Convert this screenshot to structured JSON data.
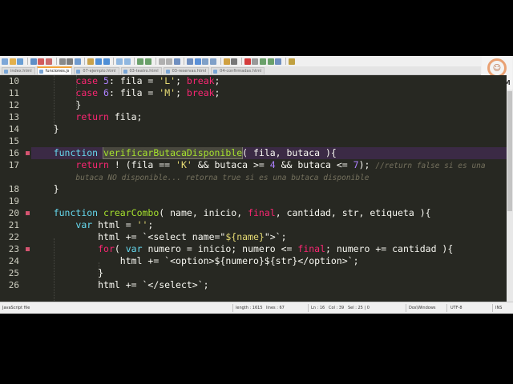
{
  "tabs": [
    {
      "label": "index.html",
      "active": false
    },
    {
      "label": "funciones.js",
      "active": true
    },
    {
      "label": "07-ejemplo.html",
      "active": false
    },
    {
      "label": "03-teatro.html",
      "active": false
    },
    {
      "label": "03-reservas.html",
      "active": false
    },
    {
      "label": "04-confirmadas.html",
      "active": false
    }
  ],
  "logo": {
    "text": "BLOOM",
    "mark": "☺"
  },
  "editor": {
    "lines": [
      {
        "num": "10",
        "fold": false
      },
      {
        "num": "11",
        "fold": false
      },
      {
        "num": "12",
        "fold": false
      },
      {
        "num": "13",
        "fold": false
      },
      {
        "num": "14",
        "fold": false
      },
      {
        "num": "15",
        "fold": false
      },
      {
        "num": "16",
        "fold": true
      },
      {
        "num": "17",
        "fold": false
      },
      {
        "num": "",
        "fold": false
      },
      {
        "num": "18",
        "fold": false
      },
      {
        "num": "19",
        "fold": false
      },
      {
        "num": "20",
        "fold": true
      },
      {
        "num": "21",
        "fold": false
      },
      {
        "num": "22",
        "fold": false
      },
      {
        "num": "23",
        "fold": true
      },
      {
        "num": "24",
        "fold": false
      },
      {
        "num": "25",
        "fold": false
      },
      {
        "num": "26",
        "fold": false
      }
    ],
    "code": {
      "l10": {
        "kw": "case",
        "num": "5",
        "mid": ": fila = ",
        "str": "'L'",
        "sep": "; ",
        "brk": "break",
        "end": ";"
      },
      "l11": {
        "kw": "case",
        "num": "6",
        "mid": ": fila = ",
        "str": "'M'",
        "sep": "; ",
        "brk": "break",
        "end": ";"
      },
      "l12": {
        "text": "}"
      },
      "l13": {
        "kw": "return",
        "rest": " fila;"
      },
      "l14": {
        "text": "}"
      },
      "l16": {
        "kw": "function",
        "name": "verificarButacaDisponible",
        "sig": "( fila, butaca ){"
      },
      "l17": {
        "kw": "return",
        "p1": " ! (fila == ",
        "s1": "'K'",
        "p2": " && butaca >= ",
        "n1": "4",
        "p3": " && butaca <= ",
        "n2": "7",
        "p4": "); ",
        "comment": "//return false si es una"
      },
      "l17b": {
        "comment": "butaca NO disponible... retorna true si es una butaca disponible"
      },
      "l18": {
        "text": "}"
      },
      "l20": {
        "kw": "function",
        "name": "crearCombo",
        "sig1": "( name, inicio, ",
        "finalkw": "final",
        "sig2": ", cantidad, str, etiqueta ){"
      },
      "l21": {
        "kw": "var",
        "mid": " html = ",
        "str": "''",
        "end": ";"
      },
      "l22": {
        "pre": "html += `<select name=\"",
        "tmpl": "${name}",
        "post": "\">`;"
      },
      "l23": {
        "kw": "for",
        "p1": "( ",
        "kw2": "var",
        "p2": " numero = inicio; numero <= ",
        "finalkw": "final",
        "p3": "; numero += cantidad ){"
      },
      "l24": {
        "pre": "html += `<option>",
        "t1": "${numero}",
        "t2": "${str}",
        "post": "</option>`;"
      },
      "l25": {
        "text": "}"
      },
      "l26": {
        "pre": "html += `</select>`;"
      }
    }
  },
  "statusbar": {
    "filetype": "JavaScript file",
    "length": "length : 1615",
    "lines": "lines : 67",
    "ln": "Ln : 16",
    "col": "Col : 39",
    "sel": "Sel : 25 | 0",
    "eol": "Dos\\Windows",
    "encoding": "UTF-8",
    "mode": "INS"
  },
  "colors": {
    "editor_bg": "#272822",
    "keyword": "#66d9ef",
    "control": "#f92672",
    "string": "#e6db74",
    "number": "#ae81ff",
    "function_name": "#a6e22e",
    "comment": "#75715e",
    "active_tab_accent": "#f3a33a"
  },
  "icons": [
    "new-file-icon",
    "open-icon",
    "save-icon",
    "save-all-icon",
    "close-icon",
    "close-all-icon",
    "print-icon",
    "cut-icon",
    "copy-icon",
    "paste-icon",
    "undo-icon",
    "redo-icon",
    "find-icon",
    "replace-icon",
    "zoom-in-icon",
    "zoom-out-icon",
    "sync-v-icon",
    "sync-h-icon",
    "wrap-icon",
    "all-chars-icon",
    "indent-guide-icon",
    "doc-map-icon",
    "function-list-icon",
    "folder-workspace-icon",
    "monitor-icon",
    "record-macro-icon",
    "stop-macro-icon",
    "play-macro-icon",
    "run-macro-icon",
    "save-macro-icon",
    "spellcheck-icon"
  ]
}
